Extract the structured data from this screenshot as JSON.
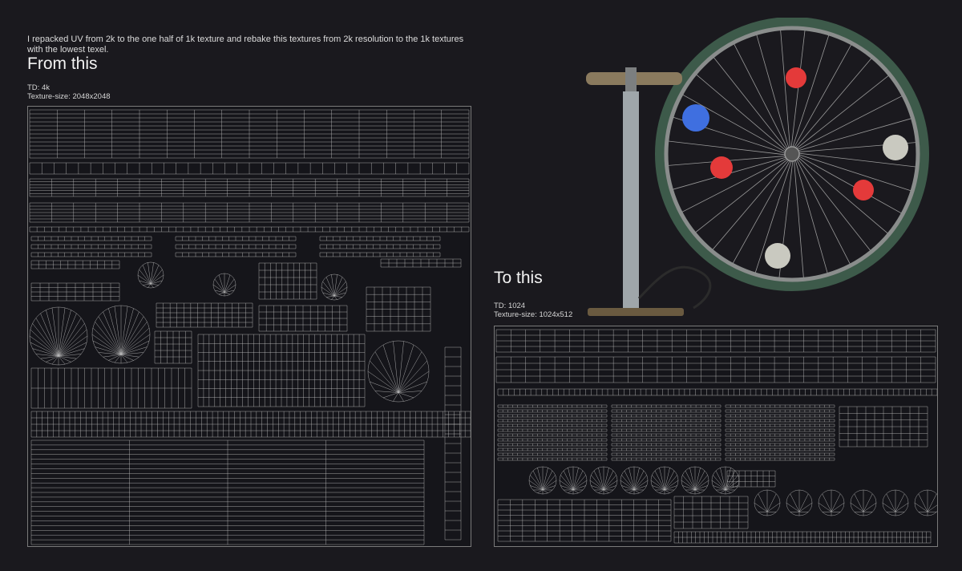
{
  "intro": "I repacked UV from 2k to the one half of 1k texture and rebake this textures from 2k resolution to the 1k textures with the lowest texel.",
  "before": {
    "heading": "From this",
    "td": "TD: 4k",
    "texture_size": "Texture-size: 2048x2048"
  },
  "after": {
    "heading": "To this",
    "td": "TD: 1024",
    "texture_size": "Texture-size: 1024x512"
  },
  "colors": {
    "background": "#1a191e",
    "wire": "#bdbdbd",
    "reflector_red": "#e43a3a",
    "reflector_blue": "#3f6fe0",
    "reflector_clear": "#c9c9c0"
  }
}
